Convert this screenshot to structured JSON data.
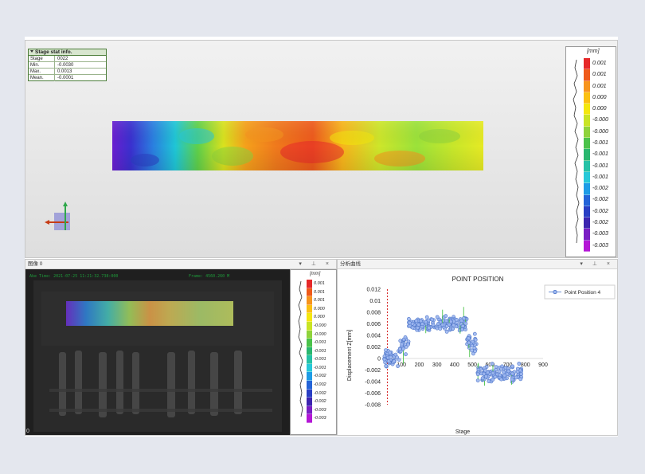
{
  "stat_box": {
    "title": "Stage stat info.",
    "rows": [
      {
        "label": "Stage",
        "value": "0022"
      },
      {
        "label": "Min.",
        "value": "-0.0030"
      },
      {
        "label": "Max.",
        "value": "0.0013"
      },
      {
        "label": "Mean.",
        "value": "-0.0001"
      }
    ]
  },
  "legend": {
    "unit": "[mm]",
    "labels": [
      "0.001",
      "0.001",
      "0.001",
      "0.000",
      "0.000",
      "-0.000",
      "-0.000",
      "-0.001",
      "-0.001",
      "-0.001",
      "-0.001",
      "-0.002",
      "-0.002",
      "-0.002",
      "-0.002",
      "-0.003",
      "-0.003"
    ],
    "colors": [
      "#e6292a",
      "#ef5a1a",
      "#f7941d",
      "#fbc011",
      "#f4e70e",
      "#c9e424",
      "#8fd33b",
      "#4bc24a",
      "#2ab76f",
      "#25c2a6",
      "#27c8d8",
      "#1e9ce6",
      "#2464d8",
      "#2a3fc4",
      "#3d25b0",
      "#7a1ec4",
      "#b417d6"
    ]
  },
  "image_pane": {
    "title": "图像 0",
    "tools": "▾ ⊥ ×",
    "ake_time": "Ake Time: 2021-07-25 11:21:32.738:000",
    "frame": "Frame: 4560.260 M",
    "corner": "0"
  },
  "curve_pane": {
    "title": "分析曲线",
    "tools": "▾ ⊥ ×"
  },
  "chart_data": {
    "type": "scatter",
    "title": "POINT POSITION",
    "xlabel": "Stage",
    "ylabel": "Displacement Z[mm]",
    "xticks": [
      "100",
      "200",
      "300",
      "400",
      "500",
      "600",
      "700",
      "800",
      "900"
    ],
    "yticks": [
      "0.012",
      "0.01",
      "0.008",
      "0.006",
      "0.004",
      "0.002",
      "0",
      "-0.002",
      "-0.004",
      "-0.006",
      "-0.008"
    ],
    "xlim": [
      0,
      900
    ],
    "ylim": [
      -0.008,
      0.012
    ],
    "legend_position": "right",
    "series": [
      {
        "name": "Point Position 4",
        "color": "#6b8fd6",
        "segments": [
          {
            "x_range": [
              0,
              90
            ],
            "y_mean": 0.0002,
            "y_spread": 0.0018
          },
          {
            "x_range": [
              90,
              140
            ],
            "y_mean": 0.002,
            "y_spread": 0.002
          },
          {
            "x_range": [
              140,
              470
            ],
            "y_mean": 0.006,
            "y_spread": 0.0014
          },
          {
            "x_range": [
              470,
              530
            ],
            "y_mean": 0.0025,
            "y_spread": 0.002
          },
          {
            "x_range": [
              530,
              780
            ],
            "y_mean": -0.0025,
            "y_spread": 0.0017
          }
        ]
      }
    ]
  },
  "colors": {
    "marker_fill": "#9db7ef",
    "marker_stroke": "#4f76c9",
    "error_bar": "#4cc34a",
    "ref_line": "#d62020"
  }
}
